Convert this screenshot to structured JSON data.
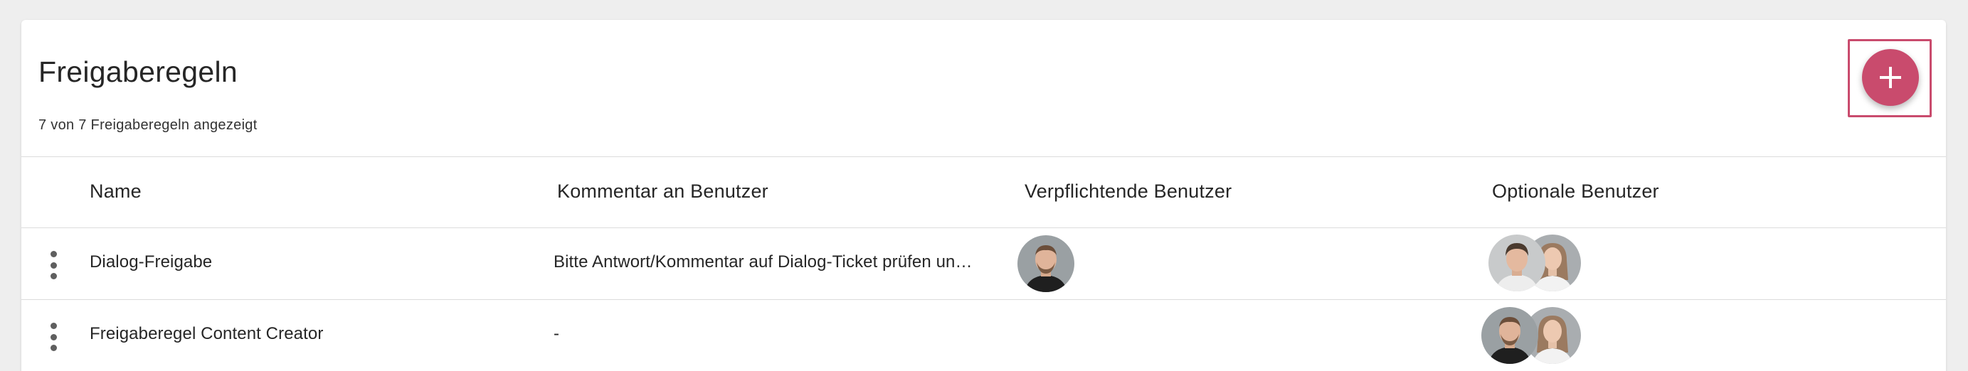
{
  "header": {
    "title": "Freigaberegeln",
    "count_text": "7 von 7 Freigaberegeln angezeigt",
    "add_icon": "plus-icon",
    "accent_color": "#c94b6d"
  },
  "table": {
    "columns": [
      "Name",
      "Kommentar an Benutzer",
      "Verpflichtende Benutzer",
      "Optionale Benutzer"
    ],
    "rows": [
      {
        "menu_icon": "more-vert-icon",
        "name": "Dialog-Freigabe",
        "comment": "Bitte Antwort/Kommentar auf Dialog-Ticket prüfen un…",
        "mandatory_users": [
          "man-avatar"
        ],
        "optional_users": [
          "man-young-avatar",
          "woman-avatar"
        ]
      },
      {
        "menu_icon": "more-vert-icon",
        "name": "Freigaberegel Content Creator",
        "comment": "-",
        "mandatory_users": [],
        "optional_users": [
          "man-avatar",
          "woman-avatar"
        ]
      }
    ]
  }
}
